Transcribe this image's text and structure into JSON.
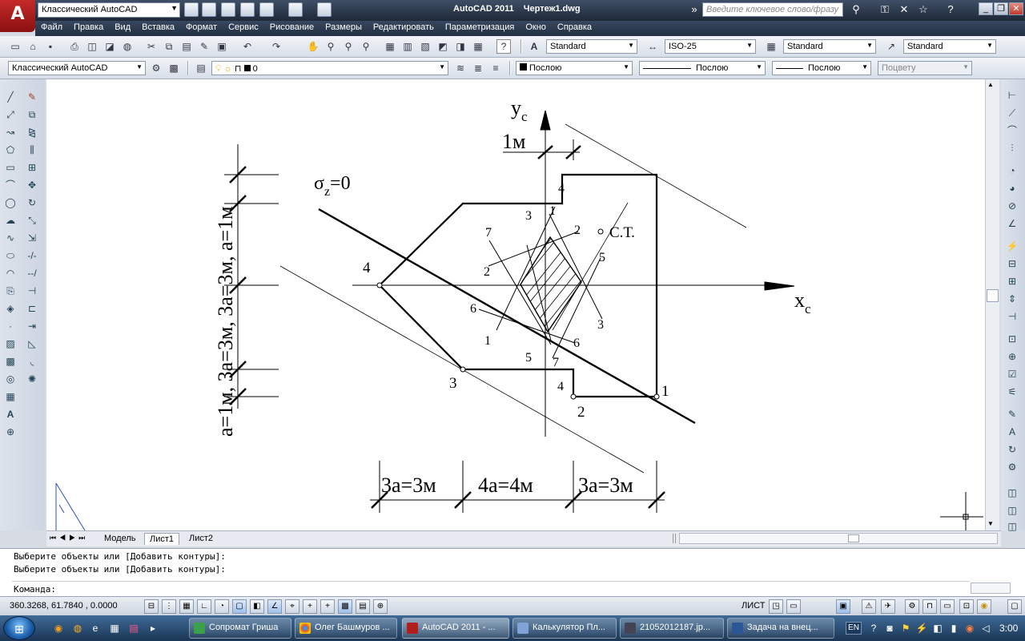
{
  "titlebar": {
    "app_name": "AutoCAD 2011",
    "document": "Чертеж1.dwg",
    "workspace": "Классический AutoCAD",
    "search_placeholder": "Введите ключевое слово/фразу"
  },
  "menu": [
    "Файл",
    "Правка",
    "Вид",
    "Вставка",
    "Формат",
    "Сервис",
    "Рисование",
    "Размеры",
    "Редактировать",
    "Параметризация",
    "Окно",
    "Справка"
  ],
  "styles_toolbar": {
    "text_style": "Standard",
    "dim_style": "ISO-25",
    "table_style": "Standard",
    "mleader_style": "Standard"
  },
  "layers_toolbar": {
    "workspace": "Классический AutoCAD",
    "layer": "0",
    "color": "Послою",
    "linetype": "Послою",
    "lineweight": "Послою",
    "plotstyle": "Поцвету"
  },
  "drawing": {
    "axis_y": "y",
    "axis_y_sub": "c",
    "axis_x": "x",
    "axis_x_sub": "c",
    "sigma": "σ",
    "sigma_sub": "z",
    "sigma_eq": "=0",
    "shear_center": "С.Т.",
    "dim_top": "1м",
    "dim_left": "a=1м, 3a=3м, 3a=3м, a=1м",
    "dim_bottom": [
      "3a=3м",
      "4a=4м",
      "3a=3м"
    ],
    "point_labels": {
      "p4_left": "4",
      "p3_bottom": "3",
      "p1_right": "1",
      "p2_bottom": "2",
      "p4_top": "4",
      "p4_bottom": "4",
      "k3_top": "3",
      "k1_top": "1",
      "k2_right": "2",
      "k7_top": "7",
      "k2_left": "2",
      "k5_right": "5",
      "k6_left": "6",
      "k3_right": "3",
      "k1_left": "1",
      "k6_right": "6",
      "k5_bottom": "5",
      "k7_bottom": "7"
    }
  },
  "tabs": {
    "model": "Модель",
    "sheet1": "Лист1",
    "sheet2": "Лист2"
  },
  "command_line": {
    "history": [
      "Выберите объекты или [Добавить контуры]:",
      "Выберите объекты или [Добавить контуры]:"
    ],
    "prompt": "Команда:"
  },
  "status": {
    "coords": "360.3268, 61.7840 , 0.0000",
    "space": "ЛИСТ"
  },
  "taskbar": {
    "tasks": [
      "Сопромат Гриша",
      "Олег Башмуров ...",
      "AutoCAD 2011 - ...",
      "Калькулятор Пл...",
      "21052012187.jp...",
      "Задача на внец..."
    ],
    "lang": "EN",
    "time": "3:00"
  },
  "colors": {
    "title_bg": "#2a3548",
    "canvas_bg": "#ffffff",
    "taskbar_bg": "#2b4d73",
    "autocad_red": "#b21e1e"
  }
}
